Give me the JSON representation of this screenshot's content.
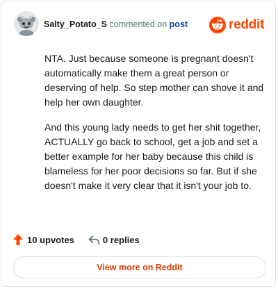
{
  "header": {
    "username": "Salty_Potato_S",
    "commented_text": "commented on",
    "post_link": "post",
    "brand": "reddit"
  },
  "comment": {
    "paragraphs": [
      "NTA. Just because someone is pregnant doesn't automatically make them a great person or deserving of help. So step mother can shove it and help her own daughter.",
      "And this young lady needs to get her shit together, ACTUALLY go back to school, get a job and set a better example for her baby because this child is blameless for her poor decisions so far. But if she doesn't make it very clear that it isn't your job to."
    ]
  },
  "footer": {
    "upvotes": "10 upvotes",
    "replies": "0 replies"
  },
  "view_more": "View more on Reddit",
  "colors": {
    "brand": "#ff4500",
    "link": "#0a449b",
    "button_text": "#d93a00"
  },
  "icons": {
    "avatar": "snoo-avatar-icon",
    "brand": "reddit-logo-icon",
    "upvote": "upvote-arrow-icon",
    "reply": "reply-arrow-icon"
  }
}
